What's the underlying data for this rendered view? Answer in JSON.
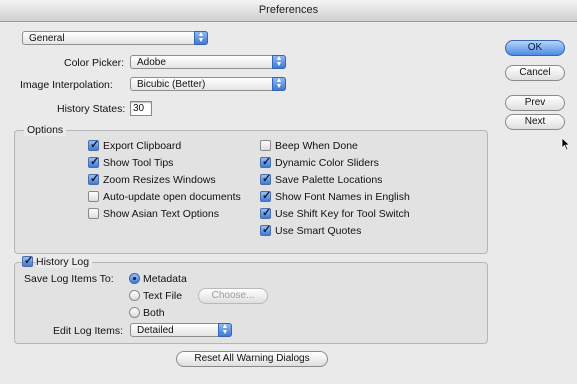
{
  "window": {
    "title": "Preferences"
  },
  "section_popup": {
    "value": "General"
  },
  "color_picker": {
    "label": "Color Picker:",
    "value": "Adobe"
  },
  "image_interpolation": {
    "label": "Image Interpolation:",
    "value": "Bicubic (Better)"
  },
  "history_states": {
    "label": "History States:",
    "value": "30"
  },
  "options": {
    "title": "Options",
    "left": [
      {
        "label": "Export Clipboard",
        "checked": true
      },
      {
        "label": "Show Tool Tips",
        "checked": true
      },
      {
        "label": "Zoom Resizes Windows",
        "checked": true
      },
      {
        "label": "Auto-update open documents",
        "checked": false
      },
      {
        "label": "Show Asian Text Options",
        "checked": false
      }
    ],
    "right": [
      {
        "label": "Beep When Done",
        "checked": false
      },
      {
        "label": "Dynamic Color Sliders",
        "checked": true
      },
      {
        "label": "Save Palette Locations",
        "checked": true
      },
      {
        "label": "Show Font Names in English",
        "checked": true
      },
      {
        "label": "Use Shift Key for Tool Switch",
        "checked": true
      },
      {
        "label": "Use Smart Quotes",
        "checked": true
      }
    ]
  },
  "history_log": {
    "label": "History Log",
    "checked": true,
    "save_to_label": "Save Log Items To:",
    "radios": [
      {
        "label": "Metadata",
        "selected": true
      },
      {
        "label": "Text File",
        "selected": false
      },
      {
        "label": "Both",
        "selected": false
      }
    ],
    "choose_label": "Choose...",
    "edit_label": "Edit Log Items:",
    "edit_value": "Detailed"
  },
  "reset_button": "Reset All Warning Dialogs",
  "buttons": {
    "ok": "OK",
    "cancel": "Cancel",
    "prev": "Prev",
    "next": "Next"
  }
}
